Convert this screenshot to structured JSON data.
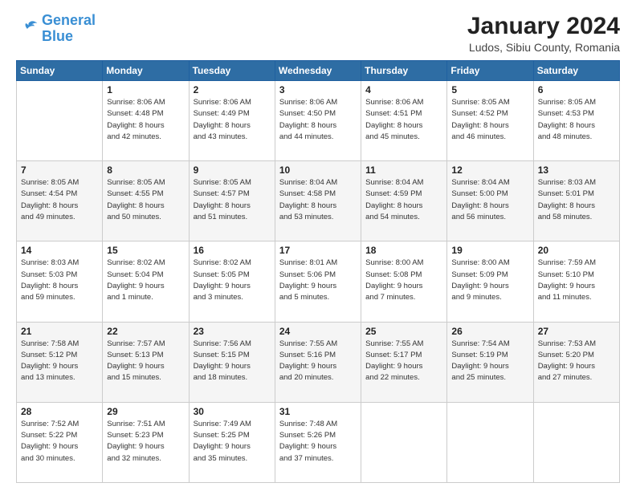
{
  "logo": {
    "line1": "General",
    "line2": "Blue"
  },
  "header": {
    "title": "January 2024",
    "subtitle": "Ludos, Sibiu County, Romania"
  },
  "weekdays": [
    "Sunday",
    "Monday",
    "Tuesday",
    "Wednesday",
    "Thursday",
    "Friday",
    "Saturday"
  ],
  "weeks": [
    [
      {
        "day": "",
        "info": ""
      },
      {
        "day": "1",
        "info": "Sunrise: 8:06 AM\nSunset: 4:48 PM\nDaylight: 8 hours\nand 42 minutes."
      },
      {
        "day": "2",
        "info": "Sunrise: 8:06 AM\nSunset: 4:49 PM\nDaylight: 8 hours\nand 43 minutes."
      },
      {
        "day": "3",
        "info": "Sunrise: 8:06 AM\nSunset: 4:50 PM\nDaylight: 8 hours\nand 44 minutes."
      },
      {
        "day": "4",
        "info": "Sunrise: 8:06 AM\nSunset: 4:51 PM\nDaylight: 8 hours\nand 45 minutes."
      },
      {
        "day": "5",
        "info": "Sunrise: 8:05 AM\nSunset: 4:52 PM\nDaylight: 8 hours\nand 46 minutes."
      },
      {
        "day": "6",
        "info": "Sunrise: 8:05 AM\nSunset: 4:53 PM\nDaylight: 8 hours\nand 48 minutes."
      }
    ],
    [
      {
        "day": "7",
        "info": "Sunrise: 8:05 AM\nSunset: 4:54 PM\nDaylight: 8 hours\nand 49 minutes."
      },
      {
        "day": "8",
        "info": "Sunrise: 8:05 AM\nSunset: 4:55 PM\nDaylight: 8 hours\nand 50 minutes."
      },
      {
        "day": "9",
        "info": "Sunrise: 8:05 AM\nSunset: 4:57 PM\nDaylight: 8 hours\nand 51 minutes."
      },
      {
        "day": "10",
        "info": "Sunrise: 8:04 AM\nSunset: 4:58 PM\nDaylight: 8 hours\nand 53 minutes."
      },
      {
        "day": "11",
        "info": "Sunrise: 8:04 AM\nSunset: 4:59 PM\nDaylight: 8 hours\nand 54 minutes."
      },
      {
        "day": "12",
        "info": "Sunrise: 8:04 AM\nSunset: 5:00 PM\nDaylight: 8 hours\nand 56 minutes."
      },
      {
        "day": "13",
        "info": "Sunrise: 8:03 AM\nSunset: 5:01 PM\nDaylight: 8 hours\nand 58 minutes."
      }
    ],
    [
      {
        "day": "14",
        "info": "Sunrise: 8:03 AM\nSunset: 5:03 PM\nDaylight: 8 hours\nand 59 minutes."
      },
      {
        "day": "15",
        "info": "Sunrise: 8:02 AM\nSunset: 5:04 PM\nDaylight: 9 hours\nand 1 minute."
      },
      {
        "day": "16",
        "info": "Sunrise: 8:02 AM\nSunset: 5:05 PM\nDaylight: 9 hours\nand 3 minutes."
      },
      {
        "day": "17",
        "info": "Sunrise: 8:01 AM\nSunset: 5:06 PM\nDaylight: 9 hours\nand 5 minutes."
      },
      {
        "day": "18",
        "info": "Sunrise: 8:00 AM\nSunset: 5:08 PM\nDaylight: 9 hours\nand 7 minutes."
      },
      {
        "day": "19",
        "info": "Sunrise: 8:00 AM\nSunset: 5:09 PM\nDaylight: 9 hours\nand 9 minutes."
      },
      {
        "day": "20",
        "info": "Sunrise: 7:59 AM\nSunset: 5:10 PM\nDaylight: 9 hours\nand 11 minutes."
      }
    ],
    [
      {
        "day": "21",
        "info": "Sunrise: 7:58 AM\nSunset: 5:12 PM\nDaylight: 9 hours\nand 13 minutes."
      },
      {
        "day": "22",
        "info": "Sunrise: 7:57 AM\nSunset: 5:13 PM\nDaylight: 9 hours\nand 15 minutes."
      },
      {
        "day": "23",
        "info": "Sunrise: 7:56 AM\nSunset: 5:15 PM\nDaylight: 9 hours\nand 18 minutes."
      },
      {
        "day": "24",
        "info": "Sunrise: 7:55 AM\nSunset: 5:16 PM\nDaylight: 9 hours\nand 20 minutes."
      },
      {
        "day": "25",
        "info": "Sunrise: 7:55 AM\nSunset: 5:17 PM\nDaylight: 9 hours\nand 22 minutes."
      },
      {
        "day": "26",
        "info": "Sunrise: 7:54 AM\nSunset: 5:19 PM\nDaylight: 9 hours\nand 25 minutes."
      },
      {
        "day": "27",
        "info": "Sunrise: 7:53 AM\nSunset: 5:20 PM\nDaylight: 9 hours\nand 27 minutes."
      }
    ],
    [
      {
        "day": "28",
        "info": "Sunrise: 7:52 AM\nSunset: 5:22 PM\nDaylight: 9 hours\nand 30 minutes."
      },
      {
        "day": "29",
        "info": "Sunrise: 7:51 AM\nSunset: 5:23 PM\nDaylight: 9 hours\nand 32 minutes."
      },
      {
        "day": "30",
        "info": "Sunrise: 7:49 AM\nSunset: 5:25 PM\nDaylight: 9 hours\nand 35 minutes."
      },
      {
        "day": "31",
        "info": "Sunrise: 7:48 AM\nSunset: 5:26 PM\nDaylight: 9 hours\nand 37 minutes."
      },
      {
        "day": "",
        "info": ""
      },
      {
        "day": "",
        "info": ""
      },
      {
        "day": "",
        "info": ""
      }
    ]
  ]
}
